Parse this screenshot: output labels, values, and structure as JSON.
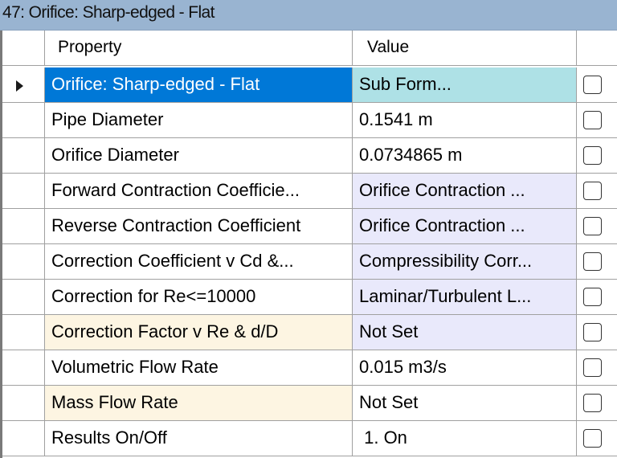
{
  "window": {
    "title": "47: Orifice: Sharp-edged - Flat"
  },
  "grid": {
    "headers": {
      "property": "Property",
      "value": "Value",
      "check": ""
    },
    "rows": [
      {
        "property": "Orifice: Sharp-edged - Flat",
        "value": "Sub Form...",
        "selected": true,
        "checked": false
      },
      {
        "property": "Pipe Diameter",
        "value": "0.1541 m",
        "checked": false
      },
      {
        "property": "Orifice Diameter",
        "value": "0.0734865 m",
        "checked": false
      },
      {
        "property": "Forward Contraction Coefficie...",
        "value": "Orifice Contraction ...",
        "checked": false
      },
      {
        "property": "Reverse Contraction Coefficient",
        "value": "Orifice Contraction ...",
        "checked": false
      },
      {
        "property": "Correction Coefficient v Cd &...",
        "value": "Compressibility Corr...",
        "checked": false
      },
      {
        "property": "Correction for Re<=10000",
        "value": "Laminar/Turbulent L...",
        "checked": false
      },
      {
        "property": "Correction Factor v Re & d/D",
        "value": "Not Set",
        "checked": false
      },
      {
        "property": "Volumetric Flow Rate",
        "value": "0.015 m3/s",
        "checked": false
      },
      {
        "property": "Mass Flow Rate",
        "value": "Not Set",
        "checked": false
      },
      {
        "property": "Results On/Off",
        "value": " 1. On",
        "checked": false
      }
    ]
  },
  "colors": {
    "title_bar": "#99b4d1",
    "selected_row": "#0078d7",
    "subform_cell": "#aee1e6",
    "linked_value_cell": "#e9e9fb",
    "unset_property_cell": "#fdf5e2"
  }
}
